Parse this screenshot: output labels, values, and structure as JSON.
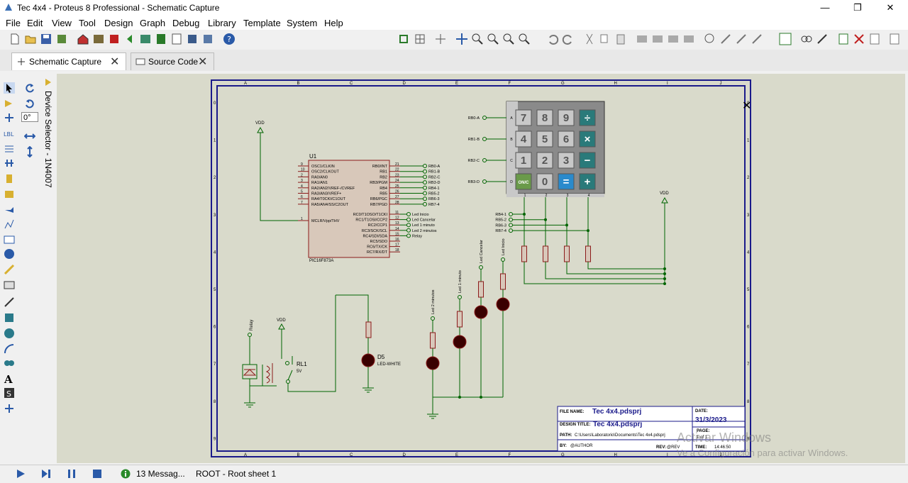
{
  "window": {
    "title": "Tec 4x4 - Proteus 8 Professional - Schematic Capture",
    "minimize": "—",
    "maximize": "❐",
    "close": "✕"
  },
  "menu": [
    "File",
    "Edit",
    "View",
    "Tool",
    "Design",
    "Graph",
    "Debug",
    "Library",
    "Template",
    "System",
    "Help"
  ],
  "tabs": [
    {
      "label": "Schematic Capture",
      "close": "✕"
    },
    {
      "label": "Source Code",
      "close": "✕"
    }
  ],
  "rotation": "0°",
  "device_selector": "Device Selector - 1N4007",
  "schematic": {
    "border_cols": [
      "A",
      "B",
      "C",
      "D",
      "E",
      "F",
      "G",
      "H",
      "I",
      "J"
    ],
    "border_rows": [
      "0",
      "1",
      "2",
      "3",
      "4",
      "5",
      "6",
      "7",
      "8",
      "9"
    ],
    "vdd": "VDD",
    "u1": {
      "ref": "U1",
      "part": "PIC16F873A",
      "left_pins": [
        {
          "n": "9",
          "name": "OSC1/CLKIN"
        },
        {
          "n": "10",
          "name": "OSC2/CLKOUT"
        },
        {
          "n": "2",
          "name": "RA0/AN0"
        },
        {
          "n": "3",
          "name": "RA1/AN1"
        },
        {
          "n": "4",
          "name": "RA2/AN2/VREF-/CVREF"
        },
        {
          "n": "5",
          "name": "RA3/AN3/VREF+"
        },
        {
          "n": "6",
          "name": "RA4/T0CKI/C1OUT"
        },
        {
          "n": "7",
          "name": "RA5/AN4/SS/C2OUT"
        },
        {
          "n": "1",
          "name": "MCLR/Vpp/THV"
        }
      ],
      "right_pins": [
        {
          "n": "21",
          "name": "RB0/INT",
          "net": "RB0-A"
        },
        {
          "n": "22",
          "name": "RB1",
          "net": "RB1-B"
        },
        {
          "n": "23",
          "name": "RB2",
          "net": "RB2-C"
        },
        {
          "n": "24",
          "name": "RB3/PGM",
          "net": "RB3-D"
        },
        {
          "n": "25",
          "name": "RB4",
          "net": "RB4-1"
        },
        {
          "n": "26",
          "name": "RB5",
          "net": "RB5-2"
        },
        {
          "n": "27",
          "name": "RB6/PGC",
          "net": "RB6-3"
        },
        {
          "n": "28",
          "name": "RB7/PGD",
          "net": "RB7-4"
        },
        {
          "n": "11",
          "name": "RC0/T1OSO/T1CKI",
          "net": "Led Inicio"
        },
        {
          "n": "12",
          "name": "RC1/T1OSI/CCP2",
          "net": "Led Cancelar"
        },
        {
          "n": "13",
          "name": "RC2/CCP1",
          "net": "Led 1 minuto"
        },
        {
          "n": "14",
          "name": "RC3/SCK/SCL",
          "net": "Led 2 minutos"
        },
        {
          "n": "15",
          "name": "RC4/SDI/SDA",
          "net": "Relay"
        },
        {
          "n": "16",
          "name": "RC5/SDO",
          "net": ""
        },
        {
          "n": "17",
          "name": "RC6/TX/CK",
          "net": ""
        },
        {
          "n": "18",
          "name": "RC7/RX/DT",
          "net": ""
        }
      ]
    },
    "keypad": {
      "rows": [
        "A",
        "B",
        "C",
        "D"
      ],
      "row_nets": [
        "RB0-A",
        "RB1-B",
        "RB2-C",
        "RB3-D"
      ],
      "cols": [
        "1",
        "2",
        "3",
        "4"
      ],
      "keys": [
        [
          "7",
          "8",
          "9",
          "÷"
        ],
        [
          "4",
          "5",
          "6",
          "×"
        ],
        [
          "1",
          "2",
          "3",
          "−"
        ],
        [
          "ON/C",
          "0",
          "=",
          "+"
        ]
      ],
      "col_nets": [
        "RB4-1",
        "RB5-2",
        "RB6-3",
        "RB7-4"
      ]
    },
    "leds": [
      "Led 2 minutos",
      "Led 1 minuto",
      "Led Cancelar",
      "Led Inicio"
    ],
    "d5": {
      "ref": "D5",
      "part": "LED-WHITE"
    },
    "relay": {
      "net": "Relay",
      "ref": "RL1",
      "value": "5V"
    },
    "title_block": {
      "file_name_label": "FILE NAME:",
      "file_name": "Tec 4x4.pdsprj",
      "date_label": "DATE:",
      "date": "31/3/2023",
      "design_title_label": "DESIGN TITLE:",
      "design_title": "Tec 4x4.pdsprj",
      "page_label": "PAGE:",
      "page": "1 of 1",
      "path_label": "PATH:",
      "path": "C:\\Users\\Laboratorio\\Documents\\Tec 4x4.pdsprj",
      "by_label": "BY:",
      "by": "@AUTHOR",
      "rev_label": "REV:",
      "rev": "@REV",
      "time_label": "TIME:",
      "time": "14:46:50"
    }
  },
  "status": {
    "messages": "13 Messag...",
    "sheet": "ROOT - Root sheet 1"
  },
  "watermark": {
    "line1": "Activar Windows",
    "line2": "Ve a Configuración para activar Windows."
  },
  "colors": {
    "wire": "#006400",
    "part_fill": "#d8c8ba",
    "part_stroke": "#8b1a1a",
    "sheet_border": "#1a1a8a",
    "canvas": "#d9dacb",
    "led": "#8b0000"
  }
}
